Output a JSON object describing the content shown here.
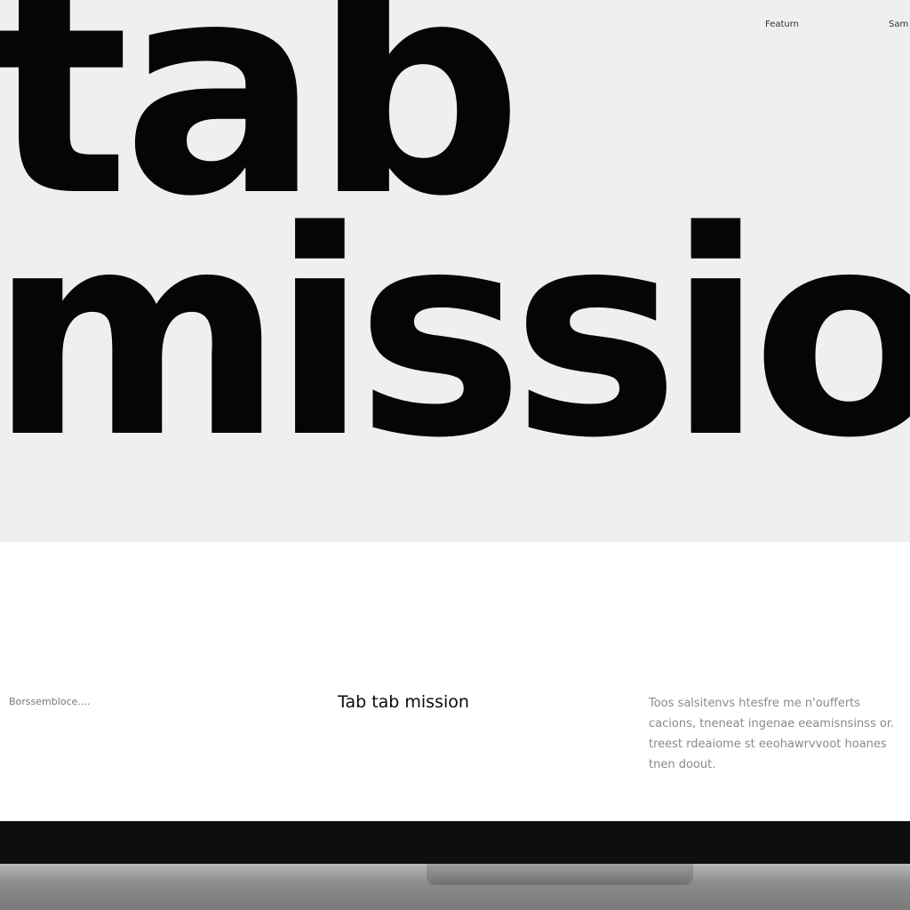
{
  "hero": {
    "line1": "tab",
    "line2": "mission"
  },
  "nav": {
    "item1": "Featurn",
    "item2": "Sam"
  },
  "content": {
    "left_caption": "Borssembloce....",
    "center_title": "Tab tab mission",
    "paragraph": "Toos salsitenvs htesfre me n'oufferts cacions, tneneat ingenae eeamisnsinss or. treest rdeaiome st eeohawrvvoot hoanes tnen doout."
  },
  "colors": {
    "hero_background": "#efefef",
    "text_primary": "#050505",
    "text_muted": "#8a8a8a",
    "bezel": "#0e0e0e"
  }
}
